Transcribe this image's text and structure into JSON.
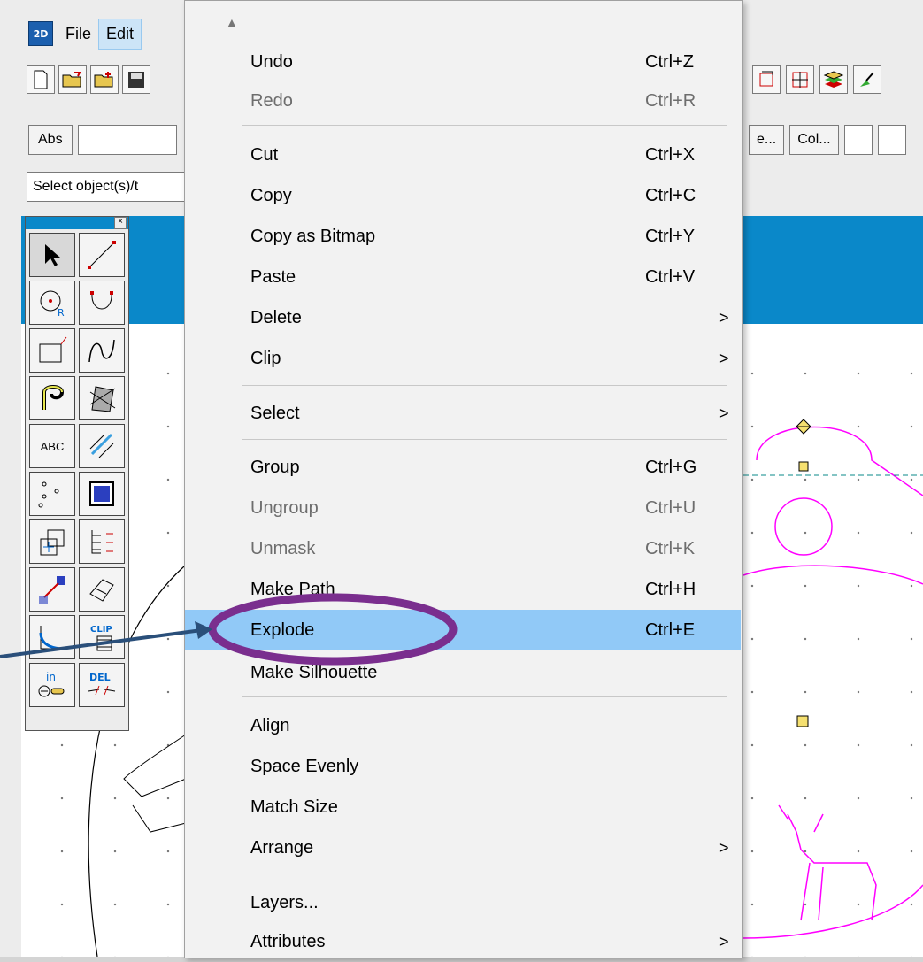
{
  "app": {
    "icon_text": "2D",
    "menus": [
      {
        "label": "File"
      },
      {
        "label": "Edit"
      }
    ]
  },
  "toolbar": {
    "left_icons": [
      "new-file-icon",
      "open-file-icon",
      "insert-file-icon",
      "save-icon"
    ],
    "right_icons": [
      "rotate-icon",
      "move-icon",
      "layers-icon",
      "paint-icon"
    ]
  },
  "row2": {
    "abs_label": "Abs",
    "ellipsis_label": "e...",
    "col_label": "Col..."
  },
  "status": {
    "text": "Select object(s)/t"
  },
  "palette": {
    "abc_label": "ABC",
    "in_label": "in",
    "del_label": "DEL",
    "clip_label": "CLIP"
  },
  "edit_menu": {
    "items": [
      {
        "label": "Undo",
        "shortcut": "Ctrl+Z",
        "disabled": false
      },
      {
        "label": "Redo",
        "shortcut": "Ctrl+R",
        "disabled": true
      },
      {
        "label": "Cut",
        "shortcut": "Ctrl+X",
        "disabled": false
      },
      {
        "label": "Copy",
        "shortcut": "Ctrl+C",
        "disabled": false
      },
      {
        "label": "Copy as Bitmap",
        "shortcut": "Ctrl+Y",
        "disabled": false
      },
      {
        "label": "Paste",
        "shortcut": "Ctrl+V",
        "disabled": false
      },
      {
        "label": "Delete",
        "shortcut": "",
        "submenu": true
      },
      {
        "label": "Clip",
        "shortcut": "",
        "submenu": true
      },
      {
        "label": "Select",
        "shortcut": "",
        "submenu": true
      },
      {
        "label": "Group",
        "shortcut": "Ctrl+G",
        "disabled": false
      },
      {
        "label": "Ungroup",
        "shortcut": "Ctrl+U",
        "disabled": true
      },
      {
        "label": "Unmask",
        "shortcut": "Ctrl+K",
        "disabled": true
      },
      {
        "label": "Make Path",
        "shortcut": "Ctrl+H",
        "disabled": false
      },
      {
        "label": "Explode",
        "shortcut": "Ctrl+E",
        "highlighted": true
      },
      {
        "label": "Make Silhouette",
        "shortcut": ""
      },
      {
        "label": "Align",
        "shortcut": ""
      },
      {
        "label": "Space Evenly",
        "shortcut": ""
      },
      {
        "label": "Match Size",
        "shortcut": ""
      },
      {
        "label": "Arrange",
        "shortcut": "",
        "submenu": true
      },
      {
        "label": "Layers...",
        "shortcut": ""
      },
      {
        "label": "Attributes",
        "shortcut": "",
        "submenu": true
      }
    ]
  },
  "colors": {
    "highlight": "#91c9f7",
    "annotation": "#7a2e8e",
    "arrow": "#2a4f7a",
    "magenta_shape": "#ff00ff",
    "blue_band": "#0a88c9"
  }
}
